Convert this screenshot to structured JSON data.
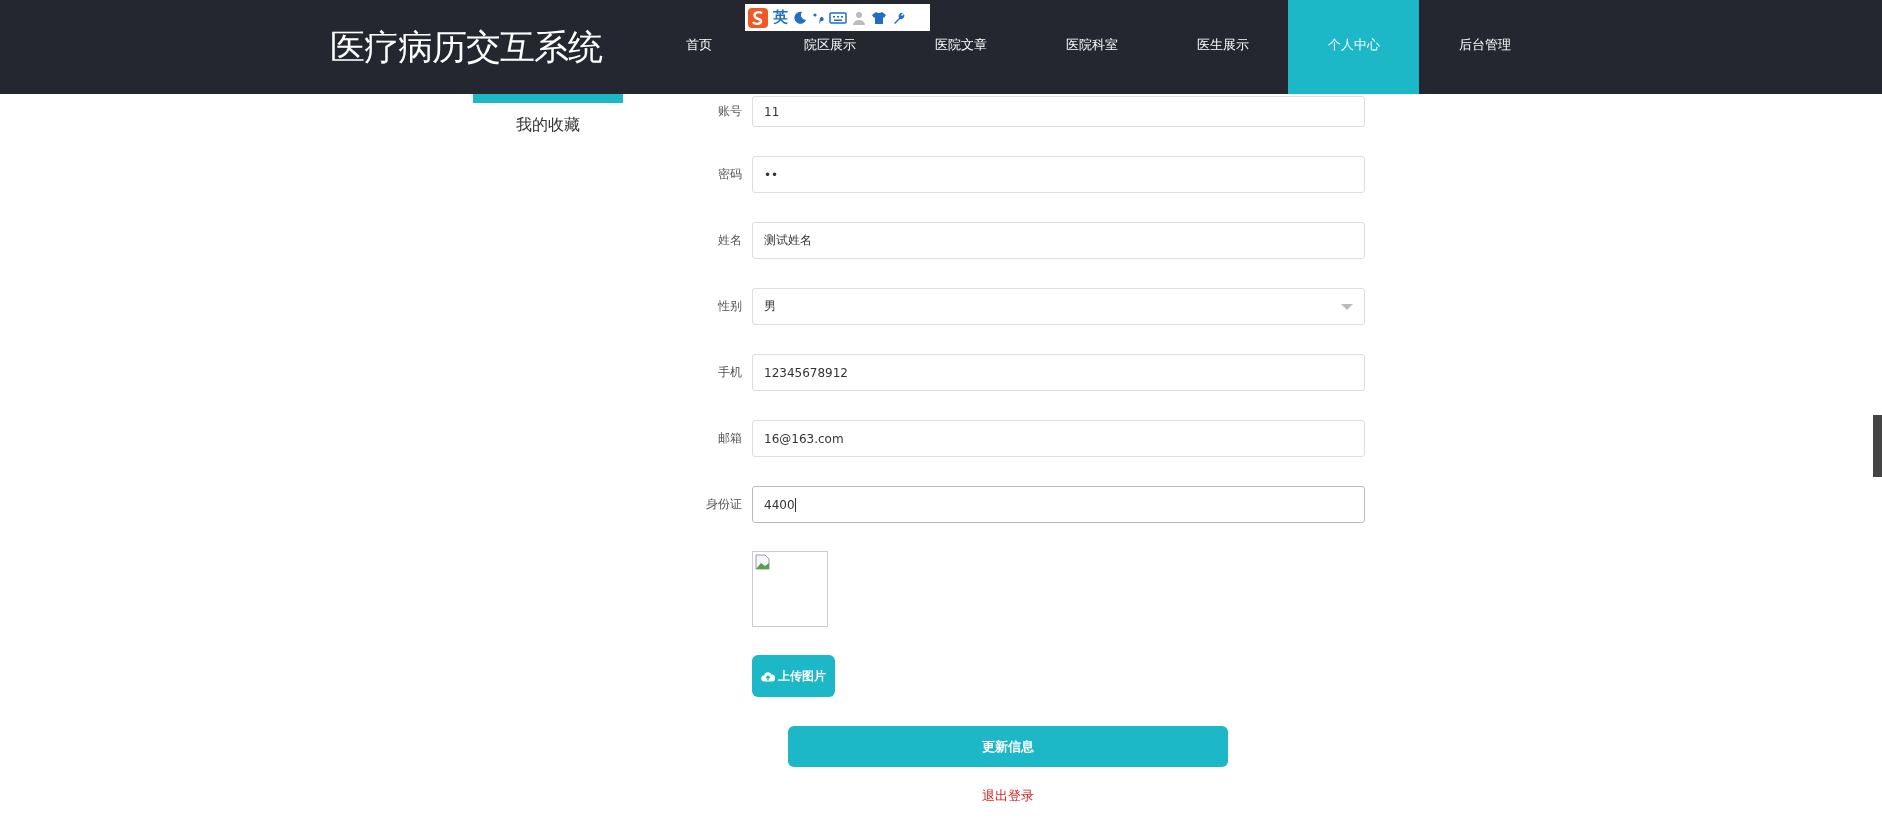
{
  "header": {
    "logo": "医疗病历交互系统",
    "nav": [
      {
        "label": "首页",
        "selected": false
      },
      {
        "label": "院区展示",
        "selected": false
      },
      {
        "label": "医院文章",
        "selected": false
      },
      {
        "label": "医院科室",
        "selected": false
      },
      {
        "label": "医生展示",
        "selected": false
      },
      {
        "label": "个人中心",
        "selected": true
      },
      {
        "label": "后台管理",
        "selected": false
      }
    ]
  },
  "ime_toolbar": {
    "mode": "英"
  },
  "sidebar": {
    "items": [
      {
        "label": "我的收藏",
        "selected": false
      }
    ]
  },
  "form": {
    "fields": [
      {
        "kind": "text",
        "label": "账号",
        "value": "11",
        "focused": false
      },
      {
        "kind": "password",
        "label": "密码",
        "value": "••",
        "focused": false
      },
      {
        "kind": "text",
        "label": "姓名",
        "value": "测试姓名",
        "focused": false
      },
      {
        "kind": "select",
        "label": "性别",
        "value": "男",
        "focused": false
      },
      {
        "kind": "text",
        "label": "手机",
        "value": "12345678912",
        "focused": false
      },
      {
        "kind": "text",
        "label": "邮箱",
        "value": "16@163.com",
        "focused": false
      },
      {
        "kind": "text",
        "label": "身份证",
        "value": "4400",
        "focused": true
      }
    ],
    "upload_button": "上传图片",
    "submit_button": "更新信息",
    "logout_link": "退出登录"
  }
}
